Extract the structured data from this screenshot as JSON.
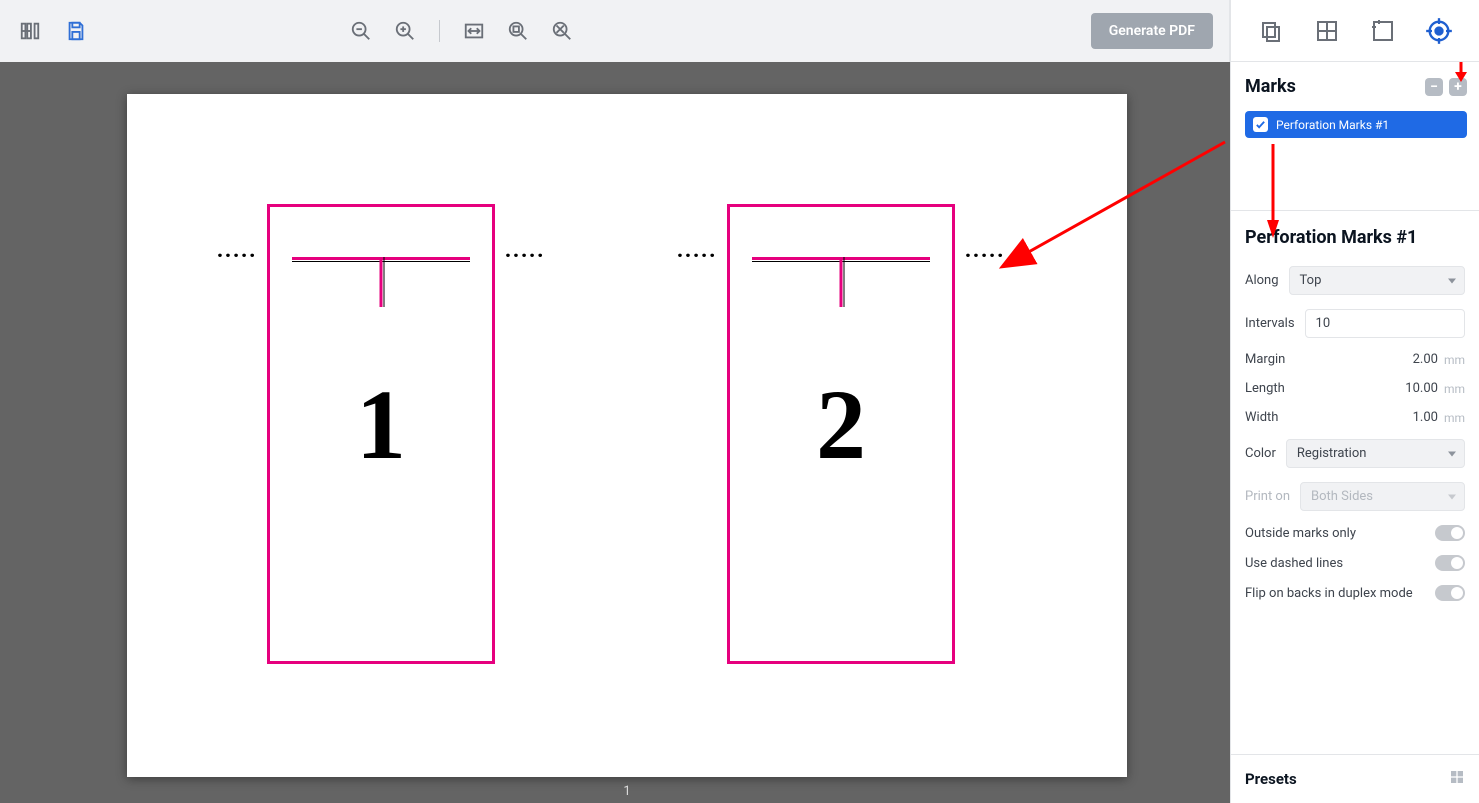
{
  "toolbar": {
    "generate_label": "Generate PDF"
  },
  "canvas": {
    "page_number": "1",
    "boxes": [
      {
        "number": "1"
      },
      {
        "number": "2"
      }
    ]
  },
  "sidebar": {
    "marks": {
      "title": "Marks",
      "item_label": "Perforation Marks #1"
    },
    "props": {
      "title": "Perforation Marks #1",
      "along": {
        "label": "Along",
        "value": "Top"
      },
      "intervals": {
        "label": "Intervals",
        "value": "10"
      },
      "margin": {
        "label": "Margin",
        "value": "2.00",
        "unit": "mm"
      },
      "length": {
        "label": "Length",
        "value": "10.00",
        "unit": "mm"
      },
      "width": {
        "label": "Width",
        "value": "1.00",
        "unit": "mm"
      },
      "color": {
        "label": "Color",
        "value": "Registration"
      },
      "print_on": {
        "label": "Print on",
        "value": "Both Sides"
      },
      "outside": {
        "label": "Outside marks only"
      },
      "dashed": {
        "label": "Use dashed lines"
      },
      "flip": {
        "label": "Flip on backs in duplex mode"
      }
    },
    "presets": {
      "label": "Presets"
    }
  }
}
